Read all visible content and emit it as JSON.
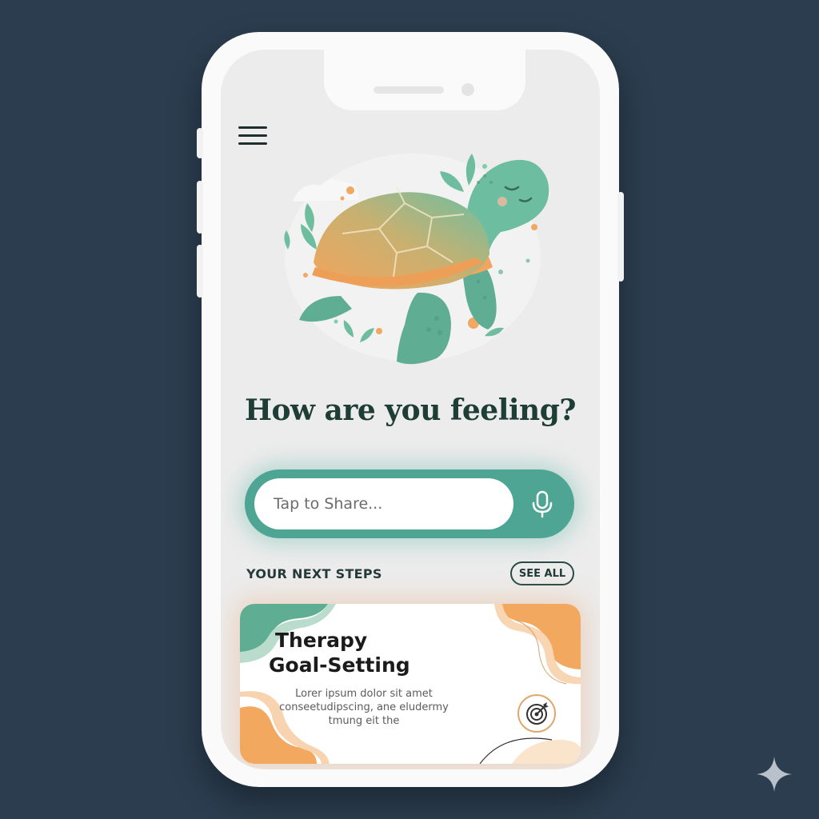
{
  "app": {
    "headline": "How are you feeling?",
    "share": {
      "placeholder": "Tap to Share..."
    },
    "next_steps": {
      "section_title": "YOUR NEXT STEPS",
      "see_all_label": "SEE ALL",
      "cards": [
        {
          "title_line1": "Therapy",
          "title_line2": "Goal-Setting",
          "body": "Lorer ipsum dolor sit amet conseetudipscing, ane eludermy tmung eit the"
        }
      ]
    }
  },
  "icons": {
    "menu": "hamburger-menu-icon",
    "mic": "microphone-icon",
    "target": "target-icon",
    "mascot": "turtle-illustration",
    "watermark": "sparkle-icon"
  },
  "colors": {
    "background": "#2b3d4f",
    "teal_accent": "#4fa594",
    "orange_accent": "#f0a25a",
    "headline": "#1e3d35"
  }
}
